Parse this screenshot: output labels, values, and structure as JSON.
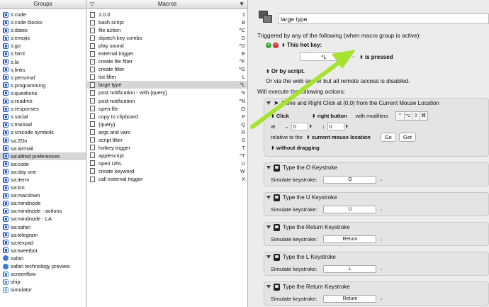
{
  "groups": {
    "header": "Groups",
    "items": [
      {
        "label": "s:code",
        "icon": "folder-icon"
      },
      {
        "label": "s:code blocks",
        "icon": "folder-icon"
      },
      {
        "label": "s:dates",
        "icon": "folder-icon"
      },
      {
        "label": "s:emojis",
        "icon": "folder-icon"
      },
      {
        "label": "s:go",
        "icon": "folder-icon"
      },
      {
        "label": "s:html",
        "icon": "folder-icon"
      },
      {
        "label": "s:la",
        "icon": "folder-icon"
      },
      {
        "label": "s:links",
        "icon": "folder-icon"
      },
      {
        "label": "s:personal",
        "icon": "folder-icon"
      },
      {
        "label": "s:programming",
        "icon": "folder-icon"
      },
      {
        "label": "s:questions",
        "icon": "folder-icon"
      },
      {
        "label": "s:readme",
        "icon": "folder-icon"
      },
      {
        "label": "s:responses",
        "icon": "folder-icon"
      },
      {
        "label": "s:social",
        "icon": "folder-icon"
      },
      {
        "label": "s:trackad",
        "icon": "folder-icon"
      },
      {
        "label": "s:unicode symbols",
        "icon": "folder-icon"
      },
      {
        "label": "sa:2Do",
        "icon": "folder-icon"
      },
      {
        "label": "sa:airmail",
        "icon": "folder-icon"
      },
      {
        "label": "sa:alfred preferences",
        "icon": "folder-icon",
        "selected": true
      },
      {
        "label": "sa:code",
        "icon": "folder-icon"
      },
      {
        "label": "sa:day one",
        "icon": "folder-icon"
      },
      {
        "label": "sa:iterm",
        "icon": "folder-icon"
      },
      {
        "label": "sa:km",
        "icon": "folder-icon"
      },
      {
        "label": "sa:macdown",
        "icon": "folder-icon"
      },
      {
        "label": "sa:mindnode",
        "icon": "folder-icon"
      },
      {
        "label": "sa:mindnode - actions",
        "icon": "folder-icon"
      },
      {
        "label": "sa:mindnode - LA",
        "icon": "folder-icon"
      },
      {
        "label": "sa:safari",
        "icon": "folder-icon"
      },
      {
        "label": "sa:telegram",
        "icon": "folder-icon"
      },
      {
        "label": "sa:texpad",
        "icon": "folder-icon"
      },
      {
        "label": "sa:tweetbot",
        "icon": "folder-icon"
      },
      {
        "label": "safari",
        "icon": "compass-icon"
      },
      {
        "label": "safari technology preview",
        "icon": "compass-icon"
      },
      {
        "label": "screenflow",
        "icon": "screen-icon"
      },
      {
        "label": "ship",
        "icon": "ship-icon"
      },
      {
        "label": "simulator",
        "icon": "simulator-icon"
      }
    ]
  },
  "macros": {
    "header": "Macros",
    "items": [
      {
        "name": "1.0.0",
        "key": "1"
      },
      {
        "name": "bash script",
        "key": "B"
      },
      {
        "name": "file action",
        "key": "^C"
      },
      {
        "name": "dipatch key combo",
        "key": "D"
      },
      {
        "name": "play sound",
        "key": "^D"
      },
      {
        "name": "external trigger",
        "key": "E"
      },
      {
        "name": "create file filter",
        "key": "^F"
      },
      {
        "name": "create filter",
        "key": "^G"
      },
      {
        "name": "list filter",
        "key": "L"
      },
      {
        "name": "large type",
        "key": "^L",
        "selected": true
      },
      {
        "name": "post notification - with {query}",
        "key": "N"
      },
      {
        "name": "post notification",
        "key": "^N"
      },
      {
        "name": "open file",
        "key": "O"
      },
      {
        "name": "copy to clipboard",
        "key": "P"
      },
      {
        "name": "{query}",
        "key": "Q"
      },
      {
        "name": "args and vars",
        "key": "R"
      },
      {
        "name": "script filter",
        "key": "S"
      },
      {
        "name": "hotkey trigger",
        "key": "T"
      },
      {
        "name": "applescript",
        "key": "^T"
      },
      {
        "name": "open URL",
        "key": "U"
      },
      {
        "name": "create keyword",
        "key": "W"
      },
      {
        "name": "call external trigger",
        "key": "X"
      }
    ]
  },
  "editor": {
    "macro_name": "large type",
    "triggered_label": "Triggered by any of the following (when macro group is active):",
    "hotkey_label": "This hot key:",
    "hotkey_value": "^L",
    "hotkey_state": "is pressed",
    "or_label": "Or by script.",
    "web_server_text": "Or via the web server but all remote access is disabled.",
    "will_execute": "Will execute the following actions:",
    "move_click": {
      "title": "Move and Right Click at (0,0) from the Current Mouse Location",
      "click": "Click",
      "button": "right button",
      "with_modifiers": "with modifiers",
      "modifiers": [
        "⌃",
        "⌥",
        "⇧",
        "⌘"
      ],
      "at_label": "at",
      "arrow_x": "→",
      "x": "0",
      "arrow_y": "↓",
      "y": "0",
      "relative_label": "relative to the",
      "relative_to": "current mouse location",
      "go": "Go",
      "get": "Get",
      "drag": "without dragging"
    },
    "keystroke_label": "Simulate keystroke:",
    "keystrokes": [
      {
        "title": "Type the O Keystroke",
        "key": "O"
      },
      {
        "title": "Type the U Keystroke",
        "key": "U"
      },
      {
        "title": "Type the Return Keystroke",
        "key": "Return"
      },
      {
        "title": "Type the L Keystroke",
        "key": "L"
      },
      {
        "title": "Type the Return Keystroke",
        "key": "Return"
      }
    ]
  },
  "colors": {
    "arrow": "#a6e22e",
    "accent": "#2a63c9",
    "selection": "#d6d6d6"
  }
}
